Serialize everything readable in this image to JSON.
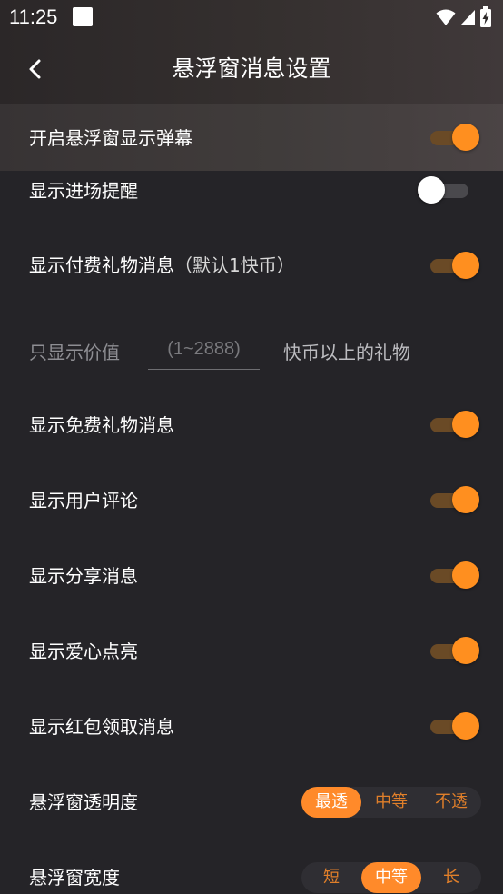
{
  "status_bar": {
    "time": "11:25"
  },
  "header": {
    "title": "悬浮窗消息设置"
  },
  "settings": {
    "float_barrage": {
      "label": "开启悬浮窗显示弹幕",
      "on": true
    },
    "entry_notice": {
      "label": "显示进场提醒",
      "on": false
    },
    "paid_gift": {
      "label": "显示付费礼物消息",
      "note": "（默认1快币）",
      "on": true
    },
    "gift_value": {
      "prefix": "只显示价值",
      "placeholder": "(1~2888)",
      "suffix": "快币以上的礼物"
    },
    "free_gift": {
      "label": "显示免费礼物消息",
      "on": true
    },
    "user_comment": {
      "label": "显示用户评论",
      "on": true
    },
    "share_message": {
      "label": "显示分享消息",
      "on": true
    },
    "heart_light": {
      "label": "显示爱心点亮",
      "on": true
    },
    "red_packet": {
      "label": "显示红包领取消息",
      "on": true
    },
    "opacity": {
      "label": "悬浮窗透明度",
      "options": [
        "最透",
        "中等",
        "不透"
      ],
      "selected": 0
    },
    "width": {
      "label": "悬浮窗宽度",
      "options": [
        "短",
        "中等",
        "长"
      ],
      "selected": 1
    }
  },
  "colors": {
    "accent": "#ff8f1f",
    "background": "#252428"
  }
}
